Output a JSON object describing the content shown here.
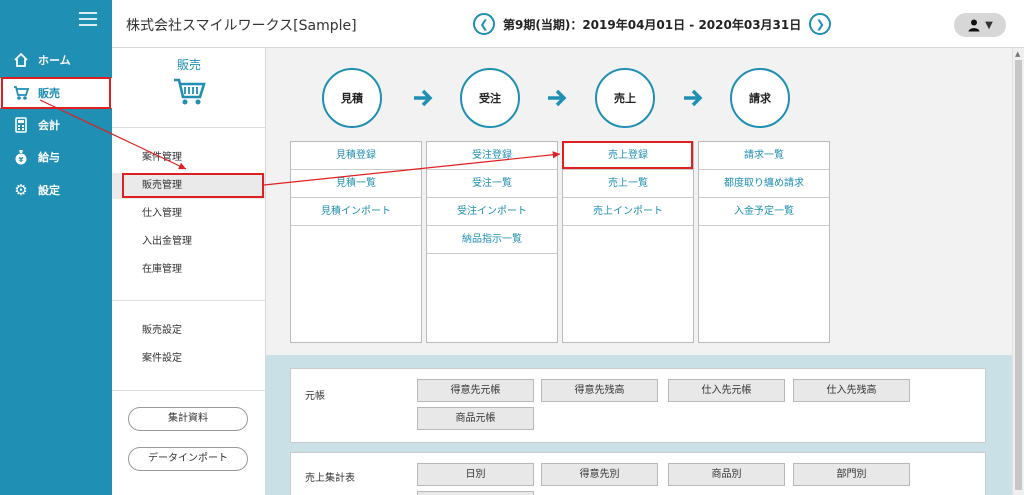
{
  "header": {
    "company": "株式会社スマイルワークス[Sample]",
    "period": "第9期(当期)：2019年04月01日 - 2020年03月31日",
    "prev_icon": "chevron-left-icon",
    "next_icon": "chevron-right-icon",
    "user_icon": "user-icon",
    "user_caret": "▼"
  },
  "nav": {
    "items": [
      {
        "label": "ホーム",
        "icon": "home-icon"
      },
      {
        "label": "販売",
        "icon": "cart-icon"
      },
      {
        "label": "会計",
        "icon": "calculator-icon"
      },
      {
        "label": "給与",
        "icon": "money-bag-icon"
      },
      {
        "label": "設定",
        "icon": "gear-icon"
      }
    ],
    "active": "販売"
  },
  "subsidebar": {
    "title": "販売",
    "items": [
      "案件管理",
      "販売管理",
      "仕入管理",
      "入出金管理",
      "在庫管理"
    ],
    "settings": [
      "販売設定",
      "案件設定"
    ],
    "buttons": [
      "集計資料",
      "データインポート"
    ]
  },
  "flow": {
    "steps": [
      "見積",
      "受注",
      "売上",
      "請求"
    ],
    "columns": [
      [
        "見積登録",
        "見積一覧",
        "見積インポート"
      ],
      [
        "受注登録",
        "受注一覧",
        "受注インポート",
        "納品指示一覧"
      ],
      [
        "売上登録",
        "売上一覧",
        "売上インポート"
      ],
      [
        "請求一覧",
        "都度取り纏め請求",
        "入金予定一覧"
      ]
    ]
  },
  "reports": {
    "ledger": {
      "title": "元帳",
      "buttons": [
        "得意先元帳",
        "得意先残高",
        "仕入先元帳",
        "仕入先残高",
        "商品元帳"
      ]
    },
    "sales_summary": {
      "title": "売上集計表",
      "buttons": [
        "日別",
        "得意先別",
        "商品別",
        "部門別"
      ]
    }
  },
  "colors": {
    "accent": "#1f8fb3",
    "highlight": "#e02020",
    "report_bg": "#c9e0e6"
  }
}
